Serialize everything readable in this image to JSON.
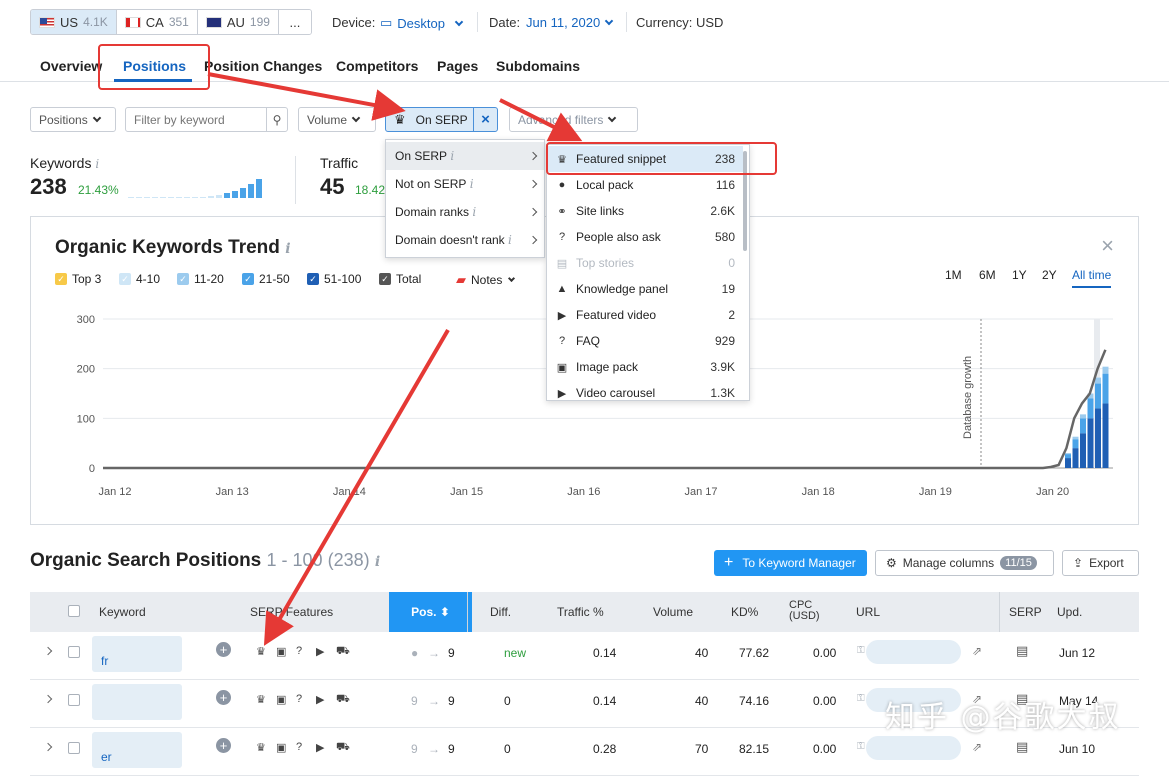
{
  "databases": [
    {
      "code": "US",
      "count": "4.1K"
    },
    {
      "code": "CA",
      "count": "351"
    },
    {
      "code": "AU",
      "count": "199"
    }
  ],
  "databases_more": "...",
  "device": {
    "label": "Device:",
    "value": "Desktop"
  },
  "date": {
    "label": "Date:",
    "value": "Jun 11, 2020"
  },
  "currency": {
    "label": "Currency:",
    "value": "USD"
  },
  "tabs": [
    "Overview",
    "Positions",
    "Position Changes",
    "Competitors",
    "Pages",
    "Subdomains"
  ],
  "filters": {
    "positions": "Positions",
    "keyword_placeholder": "Filter by keyword",
    "volume": "Volume",
    "on_serp": "On SERP",
    "advanced": "Advanced filters"
  },
  "metrics": {
    "keywords_label": "Keywords",
    "keywords_value": "238",
    "keywords_pct": "21.43%",
    "traffic_label": "Traffic",
    "traffic_value": "45",
    "traffic_pct": "18.42"
  },
  "trend": {
    "title": "Organic Keywords Trend",
    "legend": [
      {
        "label": "Top 3",
        "color": "#f7c948"
      },
      {
        "label": "4-10",
        "color": "#cfe6f6"
      },
      {
        "label": "11-20",
        "color": "#9ccbee"
      },
      {
        "label": "21-50",
        "color": "#4aa3e8"
      },
      {
        "label": "51-100",
        "color": "#1f5fb4"
      },
      {
        "label": "Total",
        "color": "#555555"
      }
    ],
    "notes": "Notes",
    "ranges": [
      "1M",
      "6M",
      "1Y",
      "2Y",
      "All time"
    ]
  },
  "chart_data": {
    "type": "bar",
    "y_ticks": [
      "300",
      "200",
      "100",
      "0"
    ],
    "ylim": [
      0,
      300
    ],
    "x_ticks": [
      "Jan 12",
      "Jan 13",
      "Jan 14",
      "Jan 15",
      "Jan 16",
      "Jan 17",
      "Jan 18",
      "Jan 19",
      "Jan 20"
    ],
    "annotation": "Database growth",
    "series": [
      {
        "name": "51-100",
        "color": "#1f5fb4",
        "values": [
          20,
          40,
          70,
          100,
          120,
          130
        ]
      },
      {
        "name": "21-50",
        "color": "#4aa3e8",
        "values": [
          8,
          18,
          30,
          40,
          50,
          60
        ]
      },
      {
        "name": "11-20",
        "color": "#9ccbee",
        "values": [
          2,
          5,
          8,
          10,
          12,
          14
        ]
      },
      {
        "name": "Top 3",
        "color": "#f7c948",
        "values": [
          0,
          0,
          0,
          0,
          0,
          0
        ]
      }
    ],
    "total_line": [
      0,
      2,
      6,
      40,
      100,
      130,
      150,
      200,
      238
    ]
  },
  "onserp_menu": [
    {
      "label": "On SERP"
    },
    {
      "label": "Not on SERP"
    },
    {
      "label": "Domain ranks"
    },
    {
      "label": "Domain doesn't rank"
    }
  ],
  "serp_features": [
    {
      "label": "Featured snippet",
      "count": "238",
      "icon": "crown-icon",
      "glyph": "♛"
    },
    {
      "label": "Local pack",
      "count": "116",
      "icon": "pin-icon",
      "glyph": "●"
    },
    {
      "label": "Site links",
      "count": "2.6K",
      "icon": "link-icon",
      "glyph": "⚭"
    },
    {
      "label": "People also ask",
      "count": "580",
      "icon": "question-icon",
      "glyph": "?"
    },
    {
      "label": "Top stories",
      "count": "0",
      "icon": "news-icon",
      "glyph": "▤"
    },
    {
      "label": "Knowledge panel",
      "count": "19",
      "icon": "grad-cap-icon",
      "glyph": "▲"
    },
    {
      "label": "Featured video",
      "count": "2",
      "icon": "video-icon",
      "glyph": "▶"
    },
    {
      "label": "FAQ",
      "count": "929",
      "icon": "faq-icon",
      "glyph": "?"
    },
    {
      "label": "Image pack",
      "count": "3.9K",
      "icon": "image-icon",
      "glyph": "▣"
    },
    {
      "label": "Video carousel",
      "count": "1.3K",
      "icon": "carousel-icon",
      "glyph": "▶"
    }
  ],
  "table": {
    "title": "Organic Search Positions",
    "range": "1 - 100 (238)",
    "keyword_manager_btn": "To Keyword Manager",
    "manage_columns_btn": "Manage columns",
    "columns_badge": "11/15",
    "export_btn": "Export",
    "headers": [
      "Keyword",
      "SERP Features",
      "Pos.",
      "Diff.",
      "Traffic %",
      "Volume",
      "KD%",
      "CPC (USD)",
      "URL",
      "SERP",
      "Upd."
    ],
    "rows": [
      {
        "keyword": "fr",
        "pos_from": "●",
        "pos": "9",
        "diff": "new",
        "traffic": "0.14",
        "volume": "40",
        "kd": "77.62",
        "cpc": "0.00",
        "upd": "Jun 12"
      },
      {
        "keyword": "",
        "pos_from": "9",
        "pos": "9",
        "diff": "0",
        "traffic": "0.14",
        "volume": "40",
        "kd": "74.16",
        "cpc": "0.00",
        "upd": "May 14"
      },
      {
        "keyword": "er",
        "pos_from": "9",
        "pos": "9",
        "diff": "0",
        "traffic": "0.28",
        "volume": "70",
        "kd": "82.15",
        "cpc": "0.00",
        "upd": "Jun 10"
      }
    ]
  },
  "watermark": "知乎 @谷歌大叔"
}
